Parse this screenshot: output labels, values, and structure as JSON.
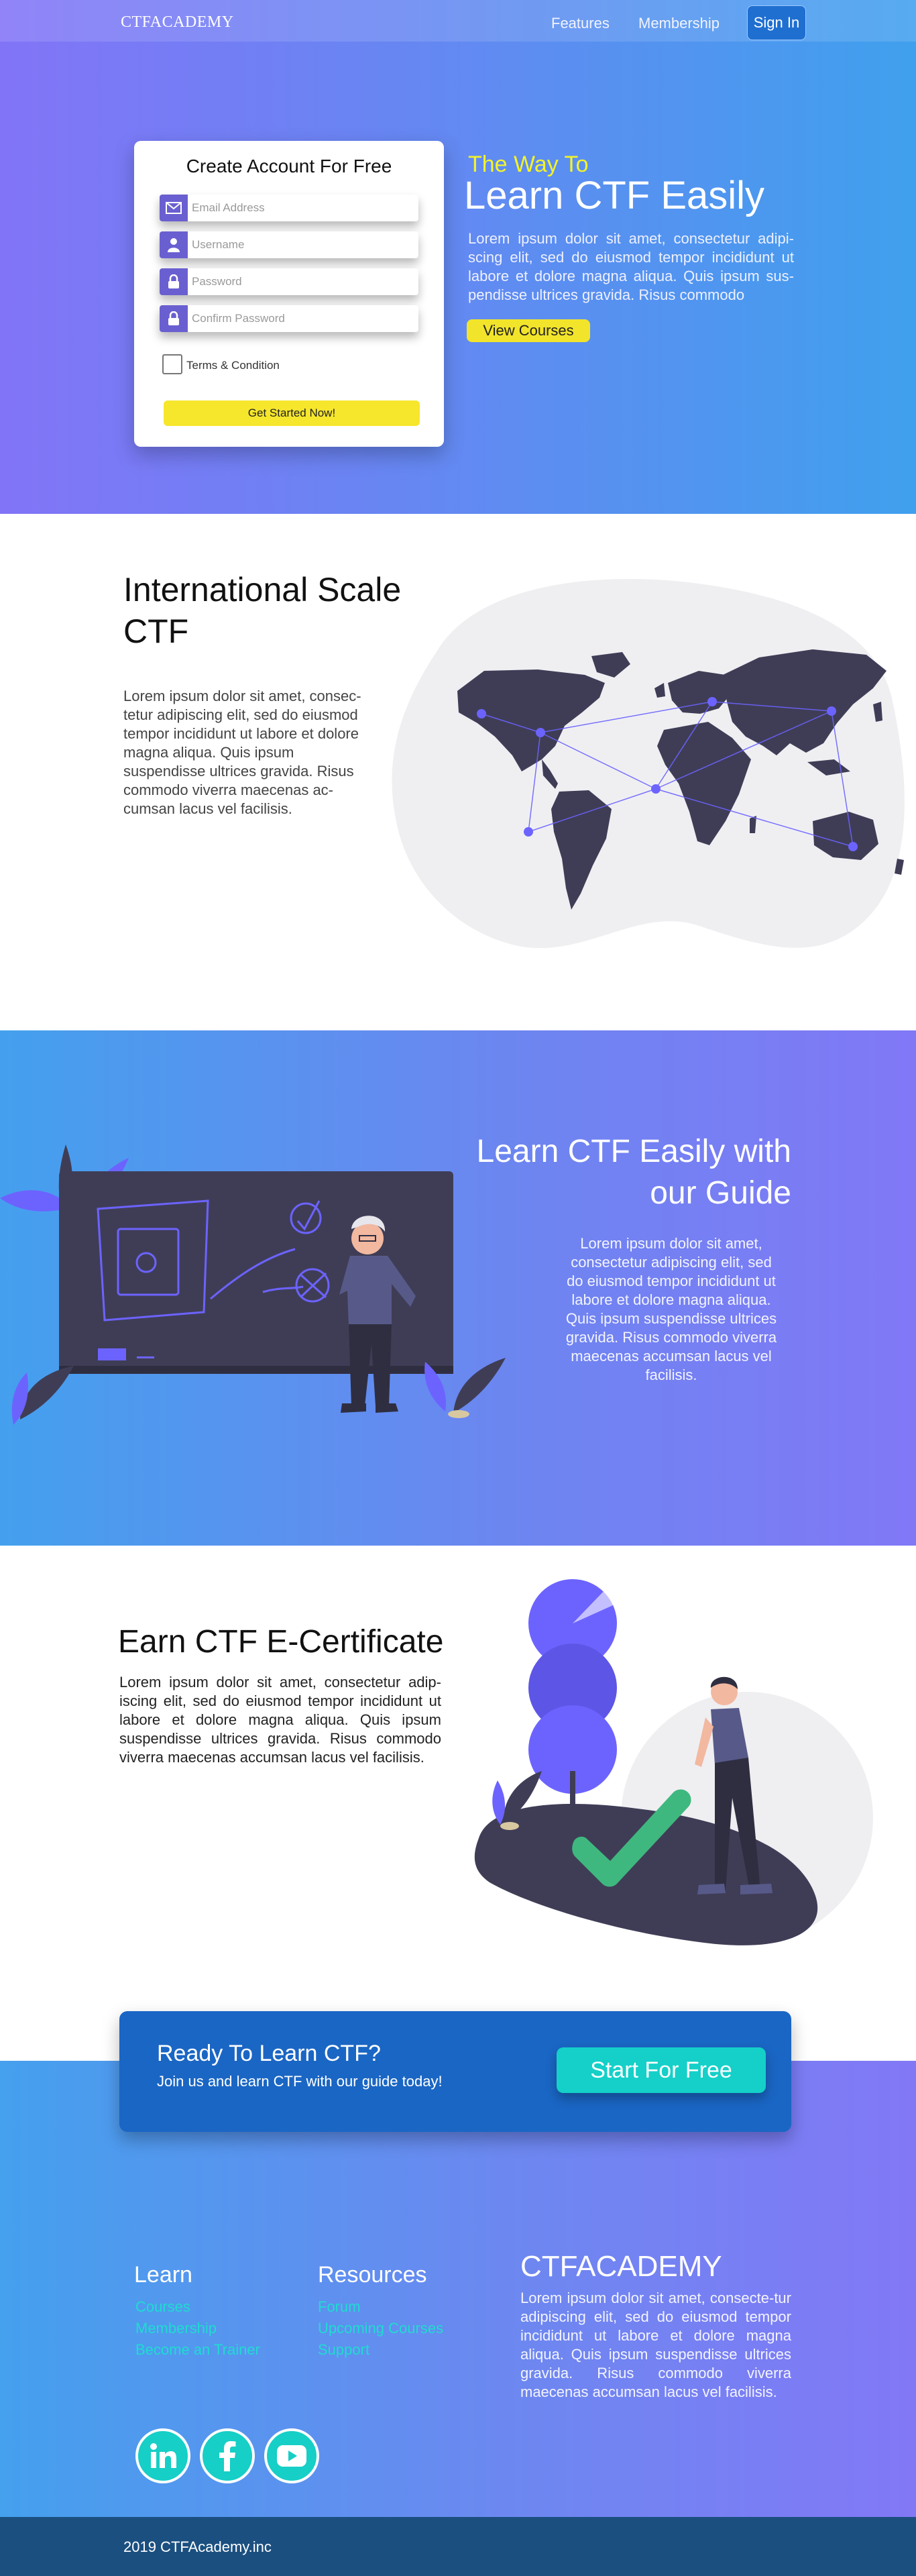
{
  "nav": {
    "brand": "CTFACADEMY",
    "features": "Features",
    "membership": "Membership",
    "signin": "Sign In"
  },
  "hero": {
    "form_title": "Create Account For Free",
    "email_placeholder": "Email Address",
    "username_placeholder": "Username",
    "password_placeholder": "Password",
    "confirm_placeholder": "Confirm Password",
    "terms": "Terms & Condition",
    "cta": "Get Started Now!",
    "subtitle": "The Way To",
    "title": "Learn CTF Easily",
    "text": "Lorem ipsum dolor sit amet, consectetur adipi-scing elit, sed do eiusmod tempor incididunt ut labore et dolore magna aliqua. Quis ipsum sus-pendisse ultrices gravida. Risus commodo",
    "view_courses": "View Courses"
  },
  "international": {
    "title": "International Scale CTF",
    "text": "Lorem ipsum dolor sit amet, consec-tetur adipiscing elit, sed do eiusmod tempor incididunt ut labore et dolore magna aliqua. Quis ipsum suspendisse ultrices gravida. Risus commodo viverra maecenas ac-cumsan lacus vel facilisis."
  },
  "guide": {
    "title": "Learn CTF Easily with our Guide",
    "text": "Lorem ipsum dolor sit amet, consectetur adipiscing elit, sed do eiusmod tempor incididunt ut labore et dolore magna aliqua. Quis ipsum suspendisse ultrices gravida. Risus commodo viverra maecenas accumsan lacus vel facilisis."
  },
  "certificate": {
    "title": "Earn CTF E-Certificate",
    "text": "Lorem ipsum dolor sit amet, consectetur adip-iscing elit, sed do eiusmod tempor incididunt ut labore et dolore magna aliqua. Quis ipsum suspendisse ultrices gravida. Risus commodo viverra maecenas accumsan lacus vel facilisis."
  },
  "cta": {
    "title": "Ready To Learn CTF?",
    "subtitle": "Join us and learn CTF with our guide today!",
    "button": "Start For Free"
  },
  "footer": {
    "learn_title": "Learn",
    "learn_links": [
      "Courses",
      "Membership",
      "Become an Trainer"
    ],
    "resources_title": "Resources",
    "resources_links": [
      "Forum",
      "Upcoming Courses",
      "Support"
    ],
    "brand": "CTFACADEMY",
    "text": "Lorem ipsum dolor sit amet, consecte-tur adipiscing elit, sed do eiusmod tempor incididunt ut labore et dolore magna aliqua. Quis ipsum suspendisse ultrices gravida. Risus commodo viverra maecenas accumsan lacus vel facilisis.",
    "social_icons": [
      "linkedin-icon",
      "facebook-icon",
      "youtube-icon"
    ],
    "copyright": "2019 CTFAcademy.inc"
  },
  "colors": {
    "gradient_purple": "#8274f7",
    "gradient_blue": "#40a0ee",
    "accent_yellow": "#f6e62c",
    "accent_teal": "#14d0c8",
    "illustration_dark": "#3f3d56",
    "illustration_purple": "#6c63ff",
    "check_green": "#3fb87f",
    "footer_bar": "#1b4f80"
  }
}
